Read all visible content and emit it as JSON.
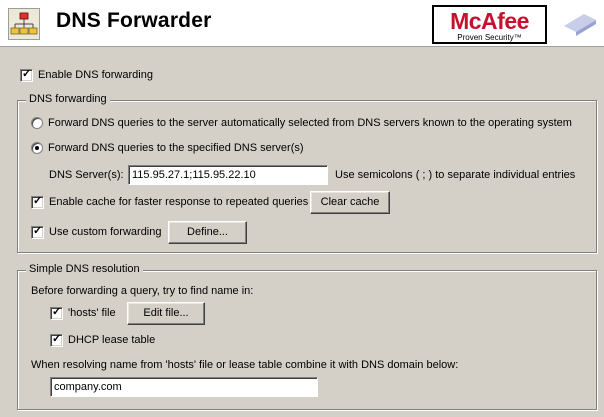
{
  "header": {
    "title": "DNS Forwarder",
    "logo_text": "McAfee",
    "logo_tagline": "Proven Security™",
    "app_icon": "network-tree-icon"
  },
  "enable_forwarding": {
    "label": "Enable DNS forwarding",
    "checked": true
  },
  "dns_forwarding": {
    "title": "DNS forwarding",
    "radio_auto_label": "Forward DNS queries to the server automatically selected from DNS servers known to the operating system",
    "radio_specified_label": "Forward DNS queries to the specified DNS server(s)",
    "selected": "specified",
    "servers_label": "DNS Server(s):",
    "servers_value": "115.95.27.1;115.95.22.10",
    "servers_hint": "Use semicolons ( ; ) to separate individual entries",
    "cache_label": "Enable cache for faster response to repeated queries",
    "cache_checked": true,
    "clear_cache_label": "Clear cache",
    "custom_label": "Use custom forwarding",
    "custom_checked": true,
    "define_label": "Define..."
  },
  "simple_resolution": {
    "title": "Simple DNS resolution",
    "intro": "Before forwarding a query, try to find name in:",
    "hosts_label": "'hosts' file",
    "hosts_checked": true,
    "edit_file_label": "Edit file...",
    "dhcp_label": "DHCP lease table",
    "dhcp_checked": true,
    "domain_label": "When resolving name from 'hosts' file or lease table combine it with DNS domain below:",
    "domain_value": "company.com"
  },
  "colors": {
    "brand_red": "#c8102e",
    "dialog_bg": "#d4d0c8"
  }
}
